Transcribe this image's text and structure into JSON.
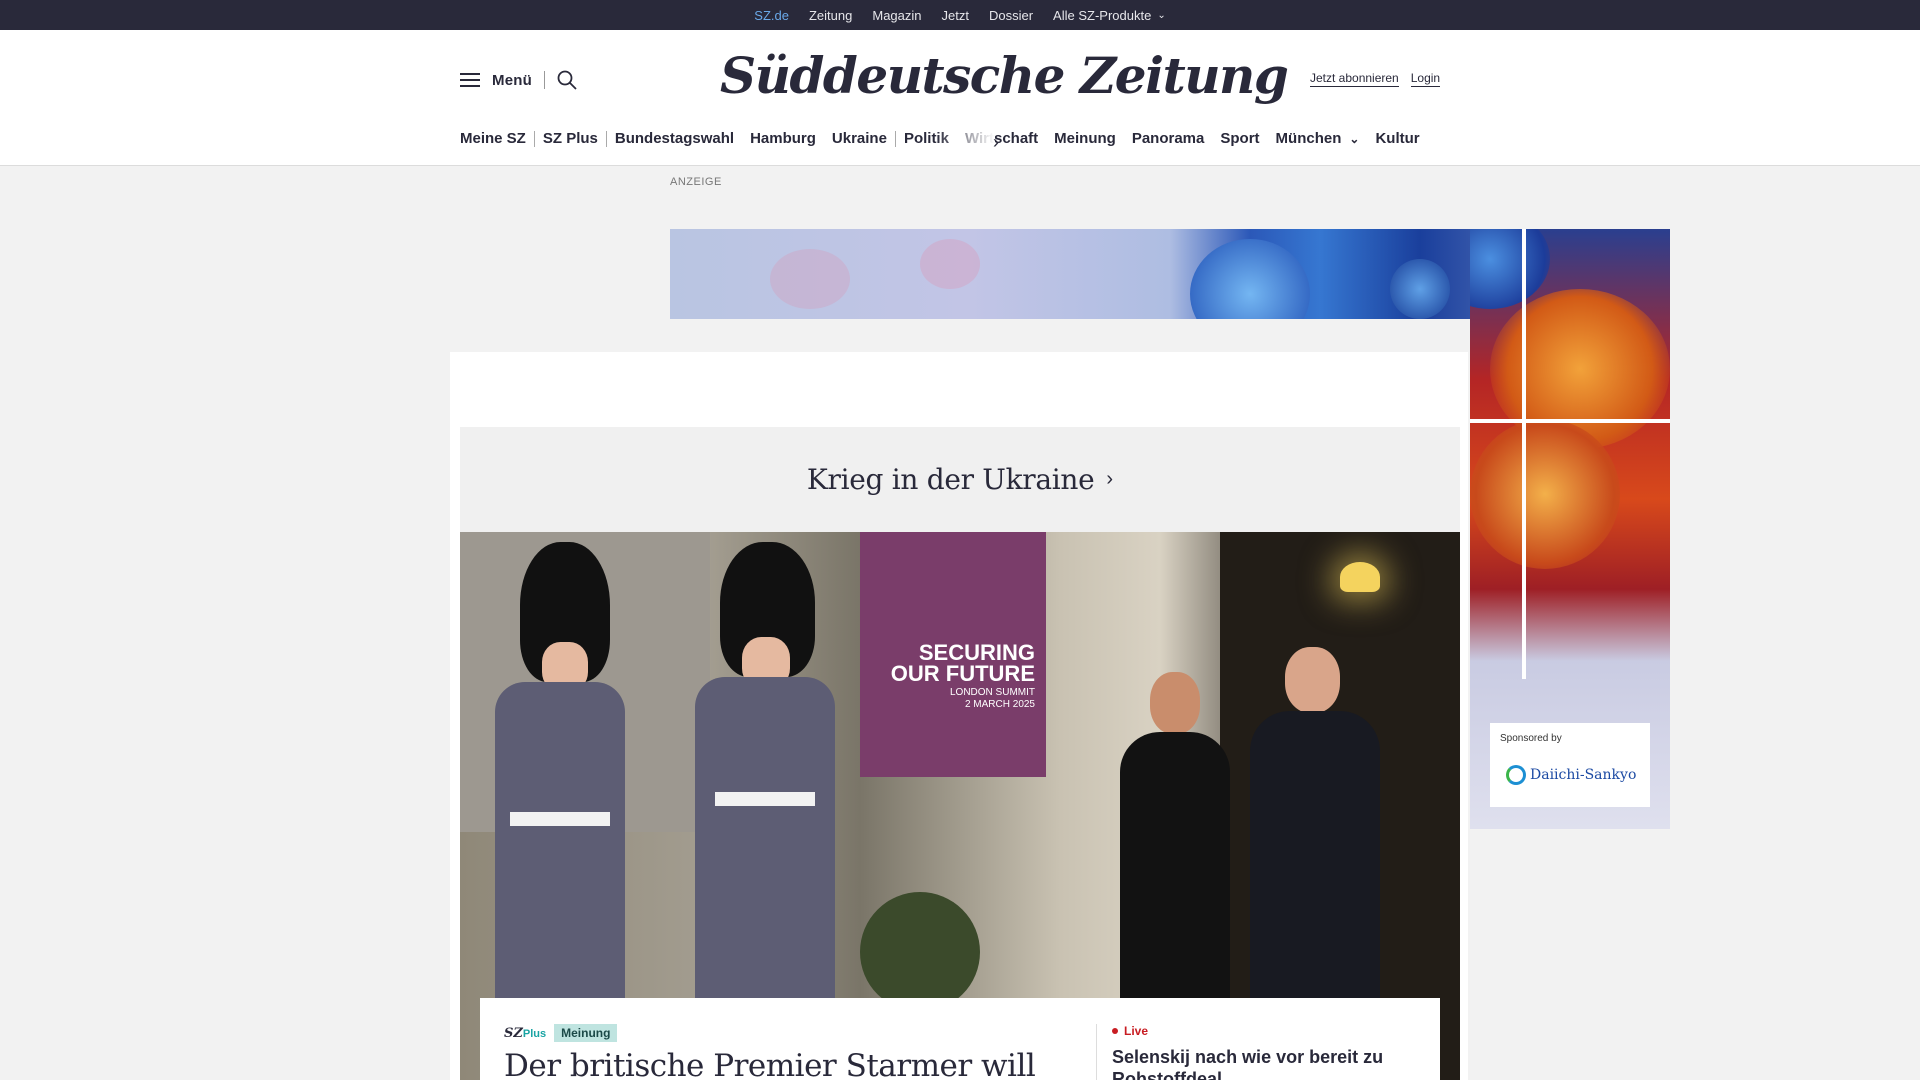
{
  "topbar": {
    "items": [
      "SZ.de",
      "Zeitung",
      "Magazin",
      "Jetzt",
      "Dossier",
      "Alle SZ-Produkte"
    ]
  },
  "header": {
    "menu_label": "Menü",
    "logo": "Süddeutsche Zeitung",
    "subscribe": "Jetzt abonnieren",
    "login": "Login"
  },
  "nav": {
    "items": [
      "Meine SZ",
      "SZ Plus",
      "Bundestagswahl",
      "Hamburg",
      "Ukraine",
      "Politik",
      "Wirtschaft",
      "Meinung",
      "Panorama",
      "Sport",
      "München",
      "Kultur"
    ]
  },
  "ad": {
    "label": "ANZEIGE",
    "sponsor_label": "Sponsored by",
    "sponsor_name": "Daiichi-Sankyo"
  },
  "dossier": {
    "title": "Krieg in der Ukraine",
    "arrow": "›"
  },
  "hero": {
    "sign_main": "SECURING OUR FUTURE",
    "sign_line1": "LONDON SUMMIT",
    "sign_line2": "2 MARCH 2025"
  },
  "teaser": {
    "sz": "SZ",
    "plus": "Plus",
    "badge": "Meinung",
    "title": "Der britische Premier Starmer will",
    "live_label": "Live",
    "live_title": "Selenskij nach wie vor bereit zu Rohstoffdeal"
  },
  "colors": {
    "dark": "#29293a",
    "accent_blue": "#6aa9e9",
    "live_red": "#c81c22",
    "meinung_bg": "#bfe4e0"
  }
}
